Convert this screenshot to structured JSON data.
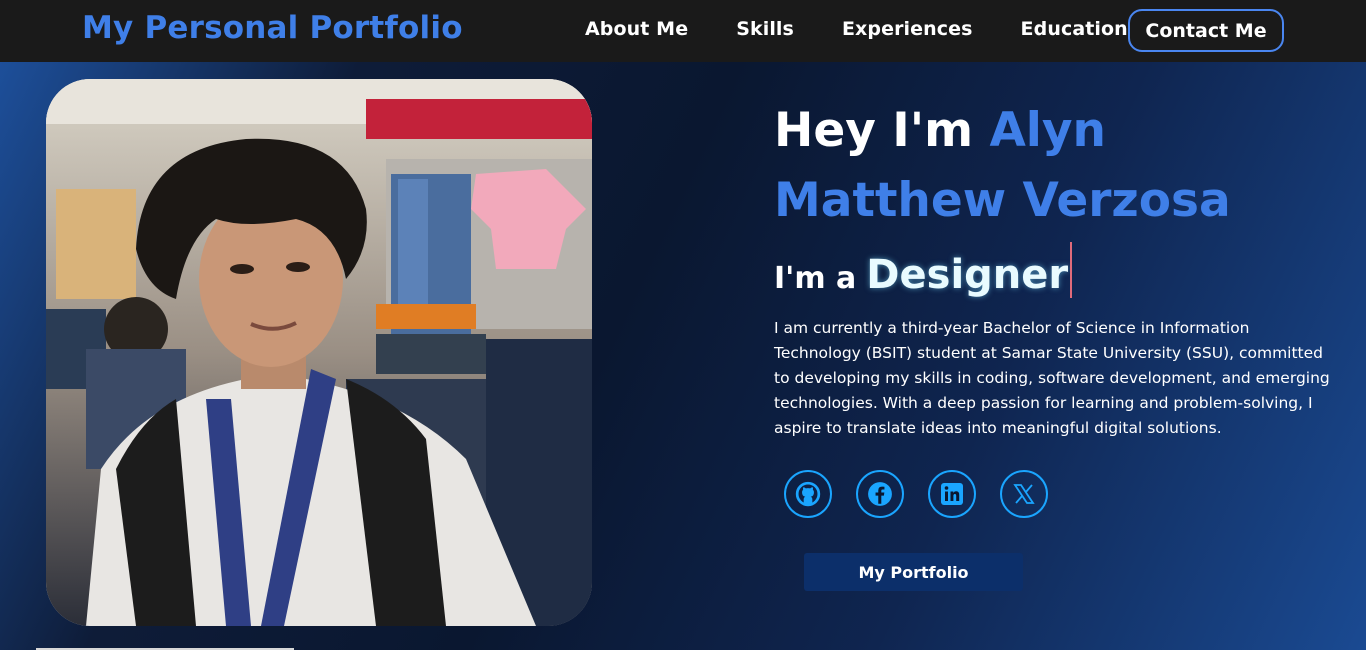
{
  "nav": {
    "brand": "My Personal Portfolio",
    "links": [
      "About Me",
      "Skills",
      "Experiences",
      "Education"
    ],
    "contact": "Contact Me"
  },
  "hero": {
    "greeting_prefix": "Hey I'm ",
    "name": "Alyn Matthew Verzosa",
    "role_prefix": "I'm a",
    "role": "Designer",
    "bio": "I am currently a third-year Bachelor of Science in Information Technology (BSIT) student at Samar State University (SSU), committed to developing my skills in coding, software development, and emerging technologies. With a deep passion for learning and problem-solving, I aspire to translate ideas into meaningful digital solutions.",
    "cta": "My Portfolio"
  },
  "socials": [
    {
      "icon": "github-icon"
    },
    {
      "icon": "facebook-icon"
    },
    {
      "icon": "linkedin-icon"
    },
    {
      "icon": "x-icon"
    }
  ],
  "colors": {
    "accent": "#3f7fe8",
    "social_ring": "#1aa5ff",
    "button": "#0c2f6a",
    "navbar": "#1a1a1a"
  }
}
